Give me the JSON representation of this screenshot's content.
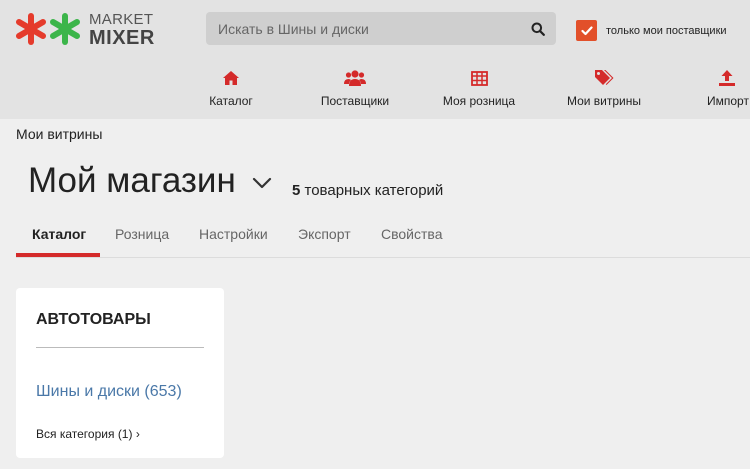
{
  "brand": {
    "line1": "MARKET",
    "line2": "MIXER",
    "colors": {
      "red": "#e53b2c",
      "green": "#3cb54a"
    }
  },
  "search": {
    "placeholder": "Искать в Шины и диски",
    "icon": "search-icon"
  },
  "filter": {
    "checked": true,
    "label": "только мои поставщики",
    "color": "#e2502a"
  },
  "nav": {
    "accent": "#d42a2a",
    "items": [
      {
        "label": "Каталог",
        "icon": "home-icon"
      },
      {
        "label": "Поставщики",
        "icon": "users-icon"
      },
      {
        "label": "Моя розница",
        "icon": "table-icon"
      },
      {
        "label": "Мои витрины",
        "icon": "tags-icon"
      },
      {
        "label": "Импорт",
        "icon": "upload-icon"
      }
    ]
  },
  "page": {
    "breadcrumb": "Мои витрины",
    "title": "Мой магазин",
    "category_count": "5",
    "category_count_suffix": "товарных категорий"
  },
  "tabs": {
    "items": [
      "Каталог",
      "Розница",
      "Настройки",
      "Экспорт",
      "Свойства"
    ],
    "active": "Каталог"
  },
  "card": {
    "title": "АВТОТОВАРЫ",
    "link": "Шины и диски (653)",
    "all_label": "Вся категория",
    "all_count": "(1)",
    "chevron": "›"
  }
}
